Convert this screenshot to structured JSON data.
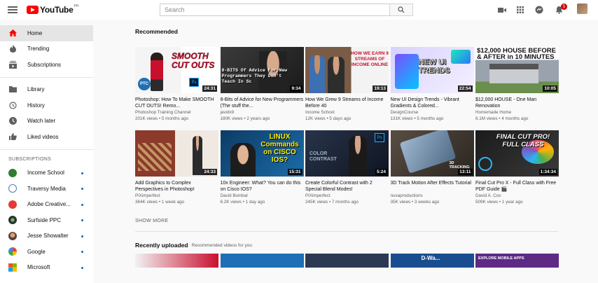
{
  "header": {
    "logo_text": "YouTube",
    "logo_region": "PH",
    "search_placeholder": "Search",
    "notifications_count": "5"
  },
  "sidebar": {
    "main": [
      {
        "label": "Home",
        "icon": "home-icon",
        "active": true
      },
      {
        "label": "Trending",
        "icon": "flame-icon"
      },
      {
        "label": "Subscriptions",
        "icon": "subscriptions-icon"
      }
    ],
    "library": [
      {
        "label": "Library",
        "icon": "folder-icon"
      },
      {
        "label": "History",
        "icon": "history-icon"
      },
      {
        "label": "Watch later",
        "icon": "clock-icon"
      },
      {
        "label": "Liked videos",
        "icon": "thumbs-up-icon"
      }
    ],
    "subscriptions_title": "SUBSCRIPTIONS",
    "subscriptions": [
      {
        "label": "Income School",
        "color": "#2f7d32"
      },
      {
        "label": "Traversy Media",
        "color": "#ffffff"
      },
      {
        "label": "Adobe Creative...",
        "color": "#e53935"
      },
      {
        "label": "Surfside PPC",
        "color": "#263238"
      },
      {
        "label": "Jesse Showalter",
        "color": "#5d4037"
      },
      {
        "label": "Google",
        "color": "#ffffff"
      },
      {
        "label": "Microsoft",
        "color": "#ffffff"
      }
    ]
  },
  "recommended": {
    "title": "Recommended",
    "row1": [
      {
        "title": "Photoshop: How To Make SMOOTH CUT OUTS! Remo...",
        "channel": "Photoshop Training Channel",
        "meta": "201K views • 5 months ago",
        "duration": "24:31",
        "overlay": "SMOOTH CUT OUTS"
      },
      {
        "title": "8-Bits of Advice for New Programmers (The stuff the...",
        "channel": "javidx9",
        "meta": "180K views • 2 years ago",
        "duration": "9:34",
        "overlay": "8-BITS Of Advice For New Programmers They Don't Teach In Sc"
      },
      {
        "title": "How We Grew 9 Streams of Income Before 40",
        "channel": "Income School",
        "meta": "12K views • 5 days ago",
        "duration": "19:13",
        "overlay": "HOW WE EARN 9 STREAMS OF INCOME ONLINE"
      },
      {
        "title": "New UI Design Trends - Vibrant Gradients & Colored...",
        "channel": "DesignCourse",
        "meta": "131K views • 5 months ago",
        "duration": "22:54",
        "overlay": "NEW UI TRENDS"
      },
      {
        "title": "$12,000 HOUSE - One Man Renovation",
        "channel": "Homemade Home",
        "meta": "6.1M views • 4 months ago",
        "duration": "10:05",
        "overlay": "$12,000 HOUSE BEFORE & AFTER in 10 MINUTES"
      }
    ],
    "row2": [
      {
        "title": "Add Graphics to Complex Perspectives in Photoshop!",
        "channel": "PiXimperfect",
        "meta": "364K views • 1 week ago",
        "duration": "24:33",
        "overlay": ""
      },
      {
        "title": "10x Engineer: What? You can do this on Cisco IOS?",
        "channel": "David Bombal",
        "meta": "6.2K views • 1 day ago",
        "duration": "15:31",
        "overlay": "LINUX Commands on CISCO IOS?"
      },
      {
        "title": "Create Colorful Contrast with 2 Special Blend Modes!",
        "channel": "PiXimperfect",
        "meta": "245K views • 7 months ago",
        "duration": "5:24",
        "overlay": "COLOR CONTRAST"
      },
      {
        "title": "3D Track Motion After Effects Tutorial",
        "channel": "nuvaproductions",
        "meta": "35K views • 3 weeks ago",
        "duration": "13:11",
        "overlay": "3D TRACKING"
      },
      {
        "title": "Final Cut Pro X - Full Class with Free PDF Guide 🎬",
        "channel": "David A. Cox",
        "meta": "509K views • 1 year ago",
        "duration": "1:34:34",
        "overlay": "FINAL CUT PRO! FULL CLASS"
      }
    ],
    "show_more": "SHOW MORE"
  },
  "recent": {
    "title": "Recently uploaded",
    "subtitle": "Recommended videos for you",
    "peek": [
      "",
      "",
      "",
      "D-Wa...",
      "EXPLORE MOBILE APPS"
    ]
  },
  "colors": {
    "brand_red": "#ff0000",
    "active_bg": "#e5e5e5",
    "dot_blue": "#1c62b9"
  }
}
